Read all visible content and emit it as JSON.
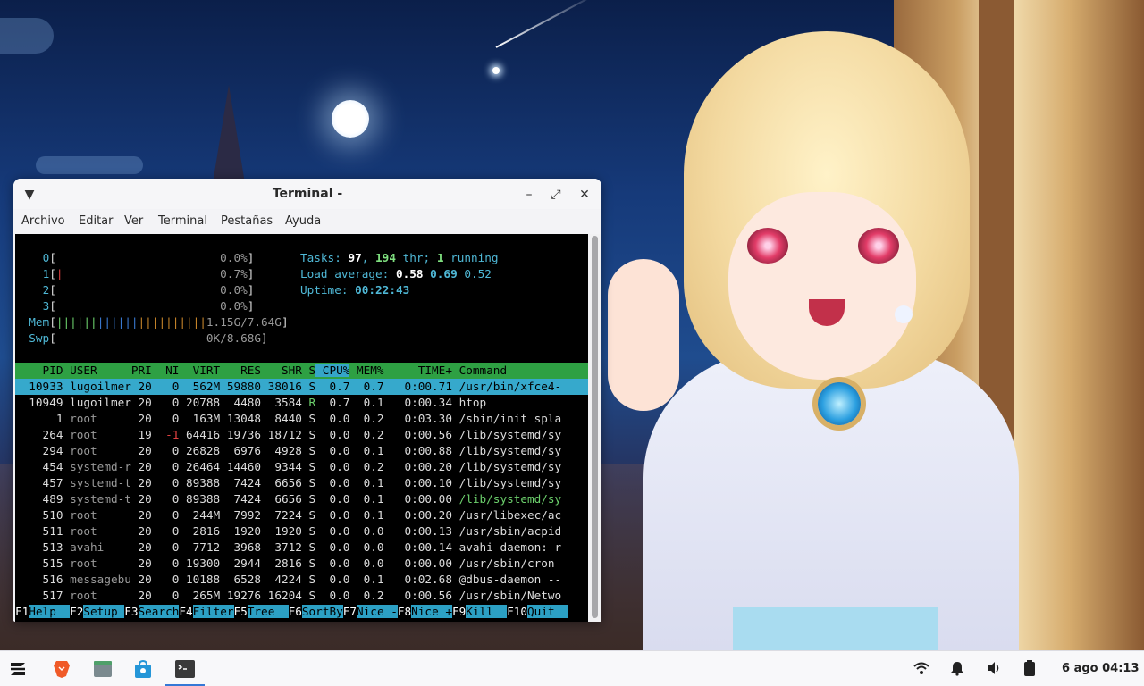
{
  "window": {
    "title": "Terminal -",
    "menu": [
      "Archivo",
      "Editar",
      "Ver",
      "Terminal",
      "Pestañas",
      "Ayuda"
    ]
  },
  "htop": {
    "cpu": [
      {
        "id": "0",
        "pct": "0.0%"
      },
      {
        "id": "1",
        "pct": "0.7%"
      },
      {
        "id": "2",
        "pct": "0.0%"
      },
      {
        "id": "3",
        "pct": "0.0%"
      }
    ],
    "mem": {
      "label": "Mem",
      "value": "1.15G/7.64G"
    },
    "swp": {
      "label": "Swp",
      "value": "0K/8.68G"
    },
    "tasks": {
      "label": "Tasks:",
      "count": "97",
      "thr": "194",
      "thr_label": "thr;",
      "running": "1",
      "running_label": "running"
    },
    "load": {
      "label": "Load average:",
      "v1": "0.58",
      "v2": "0.69",
      "v3": "0.52"
    },
    "uptime": {
      "label": "Uptime:",
      "value": "00:22:43"
    },
    "columns": [
      "PID",
      "USER",
      "PRI",
      "NI",
      "VIRT",
      "RES",
      "SHR",
      "S",
      "CPU%",
      "MEM%",
      "TIME+",
      "Command"
    ],
    "sort_column": "CPU%",
    "processes": [
      {
        "pid": "10933",
        "user": "lugoilmer",
        "pri": "20",
        "ni": "0",
        "virt": "562M",
        "res": "59880",
        "shr": "38016",
        "s": "S",
        "cpu": "0.7",
        "mem": "0.7",
        "time": "0:00.71",
        "cmd": "/usr/bin/xfce4-",
        "selected": true
      },
      {
        "pid": "10949",
        "user": "lugoilmer",
        "pri": "20",
        "ni": "0",
        "virt": "20788",
        "res": "4480",
        "shr": "3584",
        "s": "R",
        "cpu": "0.7",
        "mem": "0.1",
        "time": "0:00.34",
        "cmd": "htop"
      },
      {
        "pid": "1",
        "user": "root",
        "pri": "20",
        "ni": "0",
        "virt": "163M",
        "res": "13048",
        "shr": "8440",
        "s": "S",
        "cpu": "0.0",
        "mem": "0.2",
        "time": "0:03.30",
        "cmd": "/sbin/init spla"
      },
      {
        "pid": "264",
        "user": "root",
        "pri": "19",
        "ni": "-1",
        "virt": "64416",
        "res": "19736",
        "shr": "18712",
        "s": "S",
        "cpu": "0.0",
        "mem": "0.2",
        "time": "0:00.56",
        "cmd": "/lib/systemd/sy"
      },
      {
        "pid": "294",
        "user": "root",
        "pri": "20",
        "ni": "0",
        "virt": "26828",
        "res": "6976",
        "shr": "4928",
        "s": "S",
        "cpu": "0.0",
        "mem": "0.1",
        "time": "0:00.88",
        "cmd": "/lib/systemd/sy"
      },
      {
        "pid": "454",
        "user": "systemd-r",
        "pri": "20",
        "ni": "0",
        "virt": "26464",
        "res": "14460",
        "shr": "9344",
        "s": "S",
        "cpu": "0.0",
        "mem": "0.2",
        "time": "0:00.20",
        "cmd": "/lib/systemd/sy"
      },
      {
        "pid": "457",
        "user": "systemd-t",
        "pri": "20",
        "ni": "0",
        "virt": "89388",
        "res": "7424",
        "shr": "6656",
        "s": "S",
        "cpu": "0.0",
        "mem": "0.1",
        "time": "0:00.10",
        "cmd": "/lib/systemd/sy"
      },
      {
        "pid": "489",
        "user": "systemd-t",
        "pri": "20",
        "ni": "0",
        "virt": "89388",
        "res": "7424",
        "shr": "6656",
        "s": "S",
        "cpu": "0.0",
        "mem": "0.1",
        "time": "0:00.00",
        "cmd": "/lib/systemd/sy",
        "thread": true
      },
      {
        "pid": "510",
        "user": "root",
        "pri": "20",
        "ni": "0",
        "virt": "244M",
        "res": "7992",
        "shr": "7224",
        "s": "S",
        "cpu": "0.0",
        "mem": "0.1",
        "time": "0:00.20",
        "cmd": "/usr/libexec/ac"
      },
      {
        "pid": "511",
        "user": "root",
        "pri": "20",
        "ni": "0",
        "virt": "2816",
        "res": "1920",
        "shr": "1920",
        "s": "S",
        "cpu": "0.0",
        "mem": "0.0",
        "time": "0:00.13",
        "cmd": "/usr/sbin/acpid"
      },
      {
        "pid": "513",
        "user": "avahi",
        "pri": "20",
        "ni": "0",
        "virt": "7712",
        "res": "3968",
        "shr": "3712",
        "s": "S",
        "cpu": "0.0",
        "mem": "0.0",
        "time": "0:00.14",
        "cmd": "avahi-daemon: r"
      },
      {
        "pid": "515",
        "user": "root",
        "pri": "20",
        "ni": "0",
        "virt": "19300",
        "res": "2944",
        "shr": "2816",
        "s": "S",
        "cpu": "0.0",
        "mem": "0.0",
        "time": "0:00.00",
        "cmd": "/usr/sbin/cron "
      },
      {
        "pid": "516",
        "user": "messagebu",
        "pri": "20",
        "ni": "0",
        "virt": "10188",
        "res": "6528",
        "shr": "4224",
        "s": "S",
        "cpu": "0.0",
        "mem": "0.1",
        "time": "0:02.68",
        "cmd": "@dbus-daemon --"
      },
      {
        "pid": "517",
        "user": "root",
        "pri": "20",
        "ni": "0",
        "virt": "265M",
        "res": "19276",
        "shr": "16204",
        "s": "S",
        "cpu": "0.0",
        "mem": "0.2",
        "time": "0:00.56",
        "cmd": "/usr/sbin/Netwo"
      }
    ],
    "fkeys": [
      {
        "key": "F1",
        "label": "Help  "
      },
      {
        "key": "F2",
        "label": "Setup "
      },
      {
        "key": "F3",
        "label": "Search"
      },
      {
        "key": "F4",
        "label": "Filter"
      },
      {
        "key": "F5",
        "label": "Tree  "
      },
      {
        "key": "F6",
        "label": "SortBy"
      },
      {
        "key": "F7",
        "label": "Nice -"
      },
      {
        "key": "F8",
        "label": "Nice +"
      },
      {
        "key": "F9",
        "label": "Kill  "
      },
      {
        "key": "F10",
        "label": "Quit  "
      }
    ]
  },
  "taskbar": {
    "apps": [
      {
        "name": "zorin-menu-icon",
        "color": "#1a1a1a"
      },
      {
        "name": "brave-browser-icon",
        "color": "#f05a28"
      },
      {
        "name": "files-icon",
        "color": "#4a8a5a"
      },
      {
        "name": "software-store-icon",
        "color": "#2596d8"
      },
      {
        "name": "terminal-icon",
        "color": "#3a3a3a"
      }
    ],
    "clock": "6 ago 04:13"
  }
}
